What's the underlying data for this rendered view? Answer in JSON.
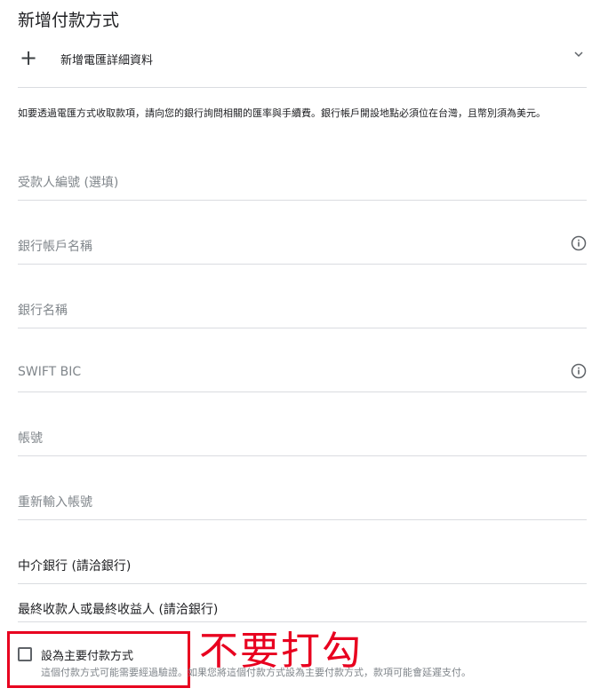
{
  "title": "新增付款方式",
  "wire_details": {
    "label": "新增電匯詳細資料"
  },
  "notice": "如要透過電匯方式收取款項，請向您的銀行詢問相關的匯率與手續費。銀行帳戶開設地點必須位在台灣，且幣別須為美元。",
  "fields": {
    "payee_id": {
      "placeholder": "受款人編號 (選填)"
    },
    "account_name": {
      "placeholder": "銀行帳戶名稱",
      "icon": "info-icon"
    },
    "bank_name": {
      "placeholder": "銀行名稱"
    },
    "swift": {
      "placeholder": "SWIFT BIC",
      "icon": "info-icon"
    },
    "account_number": {
      "placeholder": "帳號"
    },
    "account_number_confirm": {
      "placeholder": "重新輸入帳號"
    },
    "intermediary_bank": {
      "label": "中介銀行 (請洽銀行)"
    },
    "final_beneficiary": {
      "label": "最終收款人或最終收益人 (請洽銀行)"
    }
  },
  "primary_checkbox": {
    "label": "設為主要付款方式",
    "help": "這個付款方式可能需要經過驗證。如果您將這個付款方式設為主要付款方式，款項可能會延遲支付。",
    "checked": false
  },
  "annotation": {
    "text": "不要打勾",
    "color": "#e8001f"
  }
}
